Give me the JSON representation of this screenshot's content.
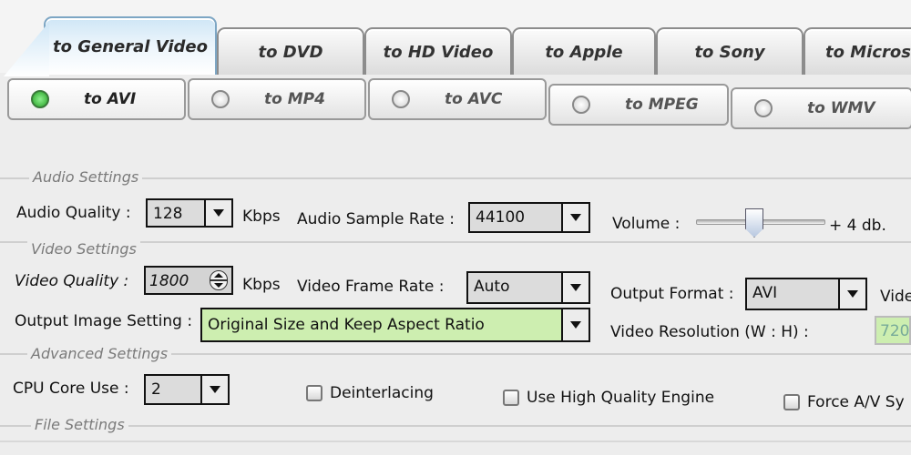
{
  "top_tabs": [
    {
      "label": "to General Video",
      "active": true
    },
    {
      "label": "to DVD",
      "active": false
    },
    {
      "label": "to HD Video",
      "active": false
    },
    {
      "label": "to Apple",
      "active": false
    },
    {
      "label": "to Sony",
      "active": false
    },
    {
      "label": "to Microso",
      "active": false
    }
  ],
  "format_tabs": [
    {
      "label": "to AVI",
      "selected": true
    },
    {
      "label": "to MP4",
      "selected": false
    },
    {
      "label": "to AVC",
      "selected": false
    },
    {
      "label": "to MPEG",
      "selected": false
    },
    {
      "label": "to WMV",
      "selected": false
    }
  ],
  "audio": {
    "section": "Audio Settings",
    "quality_label": "Audio Quality :",
    "quality_value": "128",
    "quality_unit": "Kbps",
    "sample_rate_label": "Audio Sample Rate :",
    "sample_rate_value": "44100",
    "volume_label": "Volume :",
    "volume_value": "+ 4 db."
  },
  "video": {
    "section": "Video Settings",
    "quality_label": "Video Quality :",
    "quality_value": "1800",
    "quality_unit": "Kbps",
    "frame_rate_label": "Video Frame Rate :",
    "frame_rate_value": "Auto",
    "output_format_label": "Output Format :",
    "output_format_value": "AVI",
    "cut_label": "Vide",
    "image_setting_label": "Output Image Setting :",
    "image_setting_value": "Original Size and Keep Aspect Ratio",
    "resolution_label": "Video Resolution (W : H) :",
    "resolution_value": "720"
  },
  "advanced": {
    "section": "Advanced Settings",
    "cpu_label": "CPU Core Use :",
    "cpu_value": "2",
    "deinterlacing": "Deinterlacing",
    "high_quality": "Use High Quality Engine",
    "force_av": "Force A/V Sy"
  },
  "file": {
    "section": "File Settings"
  },
  "colors": {
    "green_field": "#cdeeb0",
    "active_tab": "#cfe6f6",
    "panel": "#ededed"
  }
}
